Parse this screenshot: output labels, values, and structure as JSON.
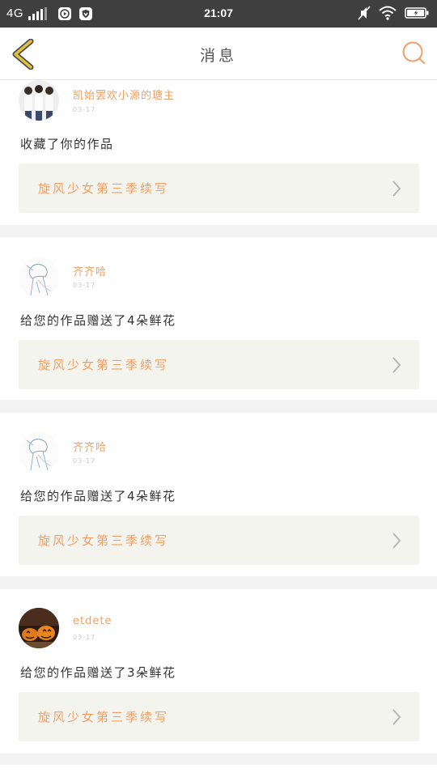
{
  "status": {
    "network": "4G",
    "time": "21:07"
  },
  "header": {
    "title": "消息"
  },
  "notifications": [
    {
      "user": "凯始罢欢小源的瑭主",
      "date": "03-17",
      "action": "收藏了你的作品",
      "work": "旋风少女第三季续写"
    },
    {
      "user": "齐齐哈",
      "date": "03-17",
      "action": "给您的作品赠送了4朵鲜花",
      "work": "旋风少女第三季续写"
    },
    {
      "user": "齐齐哈",
      "date": "03-17",
      "action": "给您的作品赠送了4朵鲜花",
      "work": "旋风少女第三季续写"
    },
    {
      "user": "etdete",
      "date": "03-17",
      "action": "给您的作品赠送了3朵鲜花",
      "work": "旋风少女第三季续写"
    }
  ],
  "colors": {
    "accent": "#f0a066",
    "back_arrow": "#e3c23a",
    "work_bg": "#f4f4ef"
  },
  "icons": {
    "back": "chevron-left-icon",
    "search": "search-icon",
    "chevron": "chevron-right-icon",
    "status": [
      "signal-icon",
      "play-app-icon",
      "shield-app-icon",
      "mute-icon",
      "wifi-icon",
      "battery-icon"
    ]
  }
}
